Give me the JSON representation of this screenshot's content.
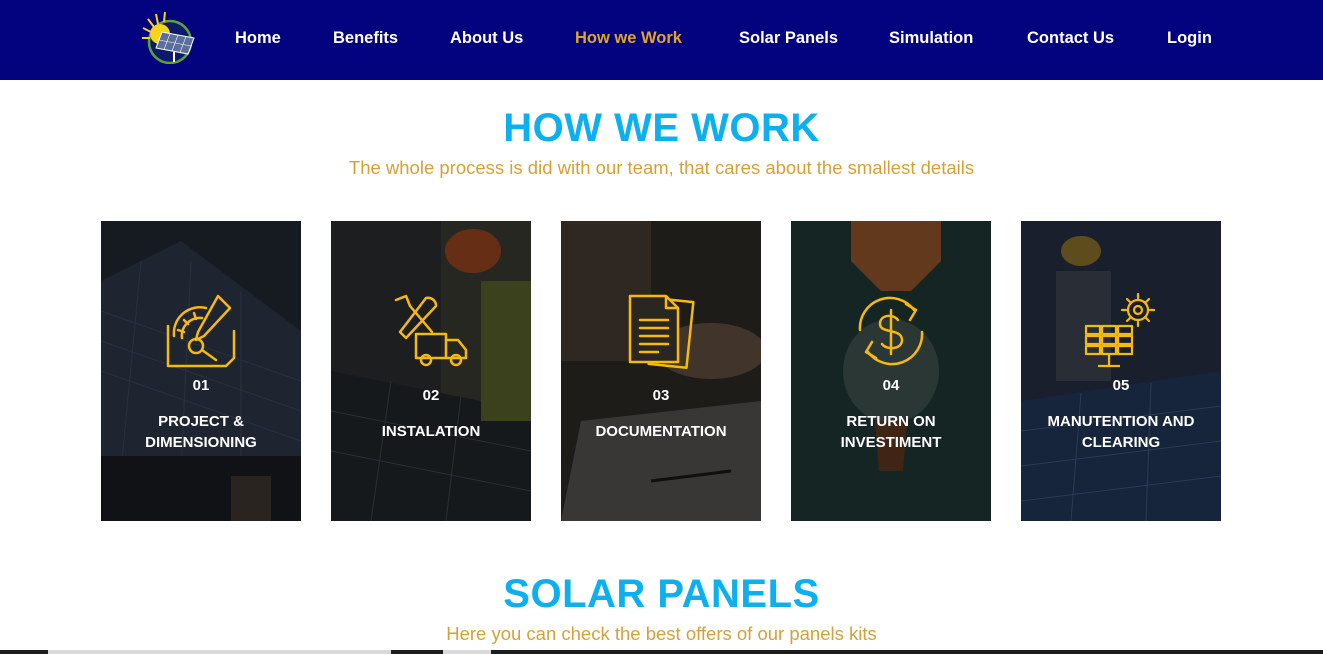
{
  "nav": {
    "logo": "solar-logo",
    "items": [
      {
        "label": "Home",
        "active": false
      },
      {
        "label": "Benefits",
        "active": false
      },
      {
        "label": "About Us",
        "active": false
      },
      {
        "label": "How we Work",
        "active": true
      },
      {
        "label": "Solar Panels",
        "active": false
      },
      {
        "label": "Simulation",
        "active": false
      },
      {
        "label": "Contact Us",
        "active": false
      },
      {
        "label": "Login",
        "active": false
      }
    ]
  },
  "how_we_work": {
    "title": "HOW WE WORK",
    "subtitle": "The whole process is did with our team, that cares about the smallest details",
    "cards": [
      {
        "number": "01",
        "label": "PROJECT & DIMENSIONING",
        "icon": "compass-pencil-icon"
      },
      {
        "number": "02",
        "label": "INSTALATION",
        "icon": "tools-truck-icon"
      },
      {
        "number": "03",
        "label": "DOCUMENTATION",
        "icon": "documents-icon"
      },
      {
        "number": "04",
        "label": "RETURN ON INVESTIMENT",
        "icon": "dollar-cycle-icon"
      },
      {
        "number": "05",
        "label": "MANUTENTION AND CLEARING",
        "icon": "panel-gear-icon"
      }
    ]
  },
  "solar_panels": {
    "title": "SOLAR PANELS",
    "subtitle": "Here you can check the best offers of our panels kits"
  },
  "colors": {
    "nav_bg": "#03027f",
    "nav_active": "#e0a42a",
    "title": "#0db0ee",
    "subtitle": "#d6a038",
    "icon_gold": "#f5b90f"
  }
}
